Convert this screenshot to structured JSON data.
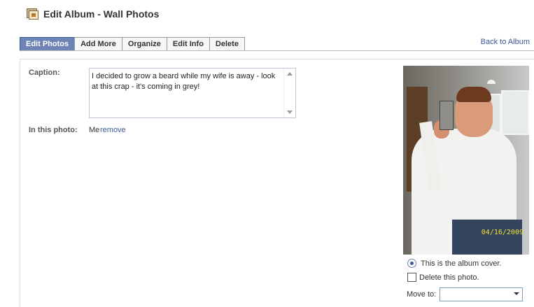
{
  "page": {
    "title": "Edit Album - Wall Photos",
    "icon": "photo-album-icon"
  },
  "tabs": [
    {
      "label": "Edit Photos",
      "active": true
    },
    {
      "label": "Add More",
      "active": false
    },
    {
      "label": "Organize",
      "active": false
    },
    {
      "label": "Edit Info",
      "active": false
    },
    {
      "label": "Delete",
      "active": false
    }
  ],
  "back_link": "Back to Album",
  "caption": {
    "label": "Caption:",
    "value": "I decided to grow a beard while my wife is away - look at this crap - it's coming in grey!"
  },
  "tags": {
    "label": "In this photo:",
    "name": "Me",
    "remove_label": "remove"
  },
  "photo": {
    "date_stamp": "04/16/2009"
  },
  "options": {
    "cover_label": "This is the album cover.",
    "cover_selected": true,
    "delete_label": "Delete this photo.",
    "delete_checked": false,
    "move_label": "Move to:",
    "move_value": ""
  },
  "colors": {
    "tab_active": "#6d84b4",
    "link": "#3b5998",
    "date_stamp": "#f0e03a"
  }
}
